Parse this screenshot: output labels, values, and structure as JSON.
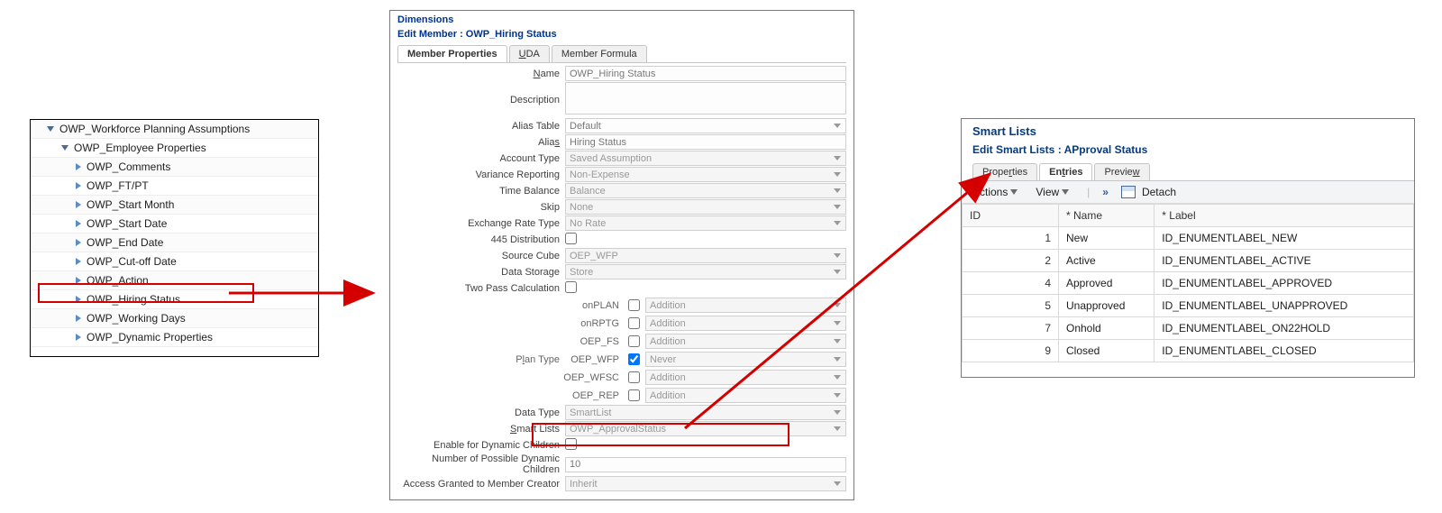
{
  "tree": {
    "root": "OWP_Workforce Planning Assumptions",
    "group": "OWP_Employee Properties",
    "items": [
      "OWP_Comments",
      "OWP_FT/PT",
      "OWP_Start Month",
      "OWP_Start Date",
      "OWP_End Date",
      "OWP_Cut-off Date",
      "OWP_Action",
      "OWP_Hiring Status",
      "OWP_Working Days",
      "OWP_Dynamic Properties"
    ],
    "selectedIndex": 7
  },
  "center": {
    "title": "Dimensions",
    "subtitle": "Edit Member : OWP_Hiring Status",
    "tabs": {
      "t1": "Member Properties",
      "t2": "UDA",
      "t3": "Member Formula"
    },
    "labels": {
      "name": "Name",
      "description": "Description",
      "aliasTable": "Alias Table",
      "alias": "Alias",
      "accountType": "Account Type",
      "varianceReporting": "Variance Reporting",
      "timeBalance": "Time Balance",
      "skip": "Skip",
      "exchangeRateType": "Exchange Rate Type",
      "dist445": "445 Distribution",
      "sourceCube": "Source Cube",
      "dataStorage": "Data Storage",
      "twoPass": "Two Pass Calculation",
      "planType": "Plan Type",
      "dataType": "Data Type",
      "smartLists": "Smart Lists",
      "enableDyn": "Enable for Dynamic Children",
      "numDyn": "Number of Possible Dynamic Children",
      "accessGranted": "Access Granted to Member Creator"
    },
    "values": {
      "name": "OWP_Hiring Status",
      "description": "",
      "aliasTable": "Default",
      "alias": "Hiring Status",
      "accountType": "Saved Assumption",
      "varianceReporting": "Non-Expense",
      "timeBalance": "Balance",
      "skip": "None",
      "exchangeRateType": "No Rate",
      "sourceCube": "OEP_WFP",
      "dataStorage": "Store",
      "dataType": "SmartList",
      "smartLists": "OWP_ApprovalStatus",
      "numDyn": "10",
      "accessGranted": "Inherit"
    },
    "plans": [
      {
        "name": "onPLAN",
        "checked": false,
        "agg": "Addition"
      },
      {
        "name": "onRPTG",
        "checked": false,
        "agg": "Addition"
      },
      {
        "name": "OEP_FS",
        "checked": false,
        "agg": "Addition"
      },
      {
        "name": "OEP_WFP",
        "checked": true,
        "agg": "Never"
      },
      {
        "name": "OEP_WFSC",
        "checked": false,
        "agg": "Addition"
      },
      {
        "name": "OEP_REP",
        "checked": false,
        "agg": "Addition"
      }
    ]
  },
  "right": {
    "title": "Smart Lists",
    "subtitle": "Edit Smart Lists : APproval Status",
    "tabs": {
      "t1": "Properties",
      "t2": "Entries",
      "t3": "Preview"
    },
    "toolbar": {
      "actions": "Actions",
      "view": "View",
      "detach": "Detach"
    },
    "headers": {
      "id": "ID",
      "name": "* Name",
      "label": "* Label"
    },
    "rows": [
      {
        "id": "1",
        "name": "New",
        "label": "ID_ENUMENTLABEL_NEW"
      },
      {
        "id": "2",
        "name": "Active",
        "label": "ID_ENUMENTLABEL_ACTIVE"
      },
      {
        "id": "4",
        "name": "Approved",
        "label": "ID_ENUMENTLABEL_APPROVED"
      },
      {
        "id": "5",
        "name": "Unapproved",
        "label": "ID_ENUMENTLABEL_UNAPPROVED"
      },
      {
        "id": "7",
        "name": "Onhold",
        "label": "ID_ENUMENTLABEL_ON22HOLD"
      },
      {
        "id": "9",
        "name": "Closed",
        "label": "ID_ENUMENTLABEL_CLOSED"
      }
    ]
  }
}
